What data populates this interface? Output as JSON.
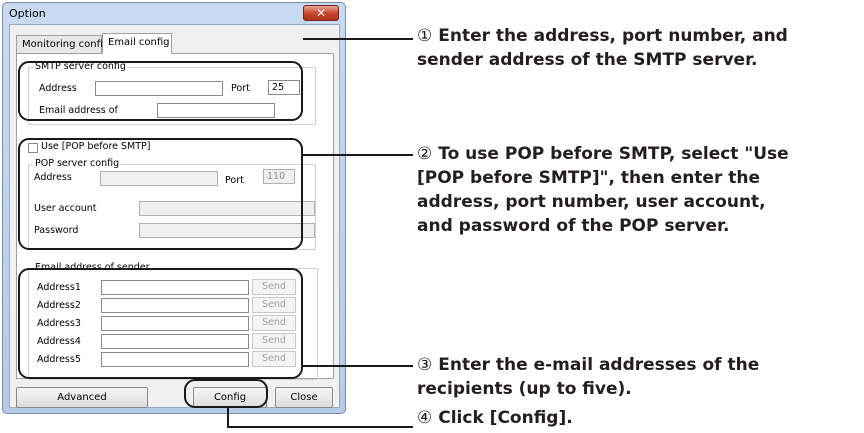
{
  "dialog": {
    "title": "Option",
    "close_glyph": "✕",
    "tabs": [
      "Monitoring config",
      "Email config"
    ],
    "active_tab": 1
  },
  "smtp": {
    "group_title": "SMTP server config",
    "address_label": "Address",
    "address_value": "",
    "port_label": "Port",
    "port_value": "25",
    "email_label": "Email address of",
    "email_value": ""
  },
  "pop": {
    "checkbox_label": "Use [POP before SMTP]",
    "checked": false,
    "group_title": "POP server config",
    "address_label": "Address",
    "address_value": "",
    "port_label": "Port",
    "port_value": "110",
    "user_label": "User account",
    "user_value": "",
    "password_label": "Password",
    "password_value": ""
  },
  "sender": {
    "group_title": "Email address of sender",
    "rows": [
      {
        "label": "Address1",
        "value": "",
        "button": "Send"
      },
      {
        "label": "Address2",
        "value": "",
        "button": "Send"
      },
      {
        "label": "Address3",
        "value": "",
        "button": "Send"
      },
      {
        "label": "Address4",
        "value": "",
        "button": "Send"
      },
      {
        "label": "Address5",
        "value": "",
        "button": "Send"
      }
    ]
  },
  "buttons": {
    "advanced": "Advanced",
    "config": "Config",
    "close": "Close"
  },
  "annotations": [
    {
      "num": "①",
      "text": "Enter the address, port number, and\nsender address of the SMTP server."
    },
    {
      "num": "②",
      "text": "To use POP before SMTP, select \"Use\n[POP before SMTP]\", then enter the\naddress, port number, user account,\nand password of the POP server."
    },
    {
      "num": "③",
      "text": "Enter the e-mail addresses of the\nrecipients (up to five)."
    },
    {
      "num": "④",
      "text": "Click [Config]."
    }
  ],
  "colors": {
    "window_frame": "#b5cbe6",
    "close_button": "#c7422b",
    "annotation_line": "#1a1a1a"
  }
}
